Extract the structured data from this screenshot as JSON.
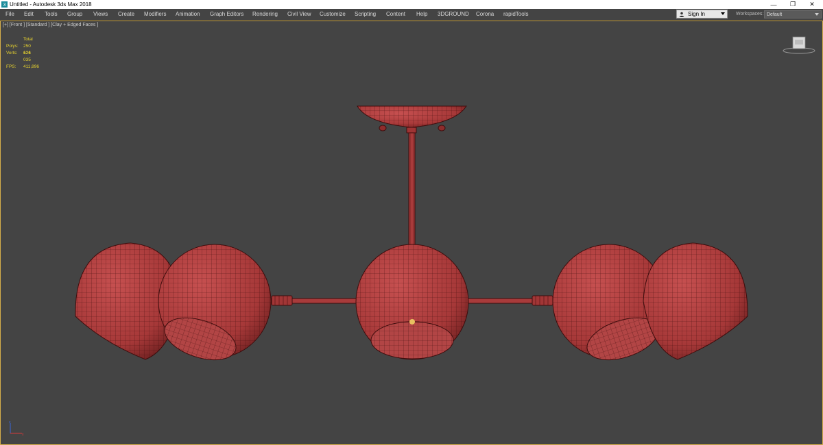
{
  "window": {
    "title": "Untitled - Autodesk 3ds Max 2018",
    "controls": {
      "minimize": "—",
      "maximize": "❐",
      "close": "✕"
    }
  },
  "menu": {
    "items": [
      "File",
      "Edit",
      "Tools",
      "Group",
      "Views",
      "Create",
      "Modifiers",
      "Animation",
      "Graph Editors",
      "Rendering",
      "Civil View",
      "Customize",
      "Scripting",
      "Content",
      "Help",
      "3DGROUND",
      "Corona",
      "rapidTools"
    ],
    "sign_in": "Sign In",
    "workspaces_label": "Workspaces:",
    "workspace_value": "Default"
  },
  "viewport": {
    "label": "[+] [Front ] [Standard ] [Clay + Edged Faces ]",
    "stats": {
      "total_label": "Total",
      "polys_label": "Polys:",
      "polys_value": "250 624",
      "verts_label": "Verts:",
      "verts_value": "126 035",
      "fps_label": "FPS:",
      "fps_value": "411,896"
    }
  },
  "colors": {
    "viewport_bg": "#444444",
    "viewport_border": "#d8b04a",
    "model": "#b94343",
    "wire": "#4a1010",
    "stats_text": "#e8d32e"
  },
  "icons": [
    "app-icon",
    "user-icon",
    "viewcube-icon",
    "axis-tripod-icon"
  ]
}
